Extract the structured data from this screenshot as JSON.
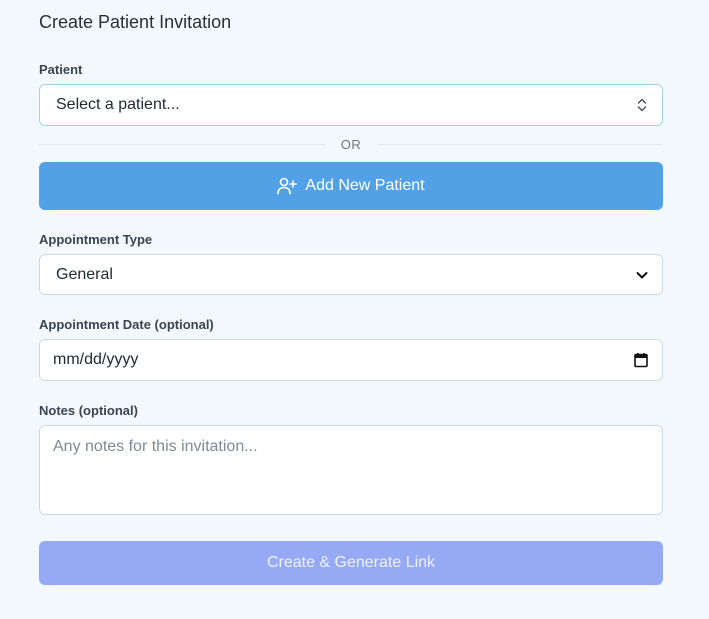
{
  "form": {
    "title": "Create Patient Invitation",
    "patient": {
      "label": "Patient",
      "value": "Select a patient..."
    },
    "divider_text": "OR",
    "add_patient_label": "Add New Patient",
    "appointment_type": {
      "label": "Appointment Type",
      "value": "General"
    },
    "appointment_date": {
      "label": "Appointment Date (optional)",
      "value": "mm/dd/yyyy"
    },
    "notes": {
      "label": "Notes (optional)",
      "placeholder": "Any notes for this invitation..."
    },
    "submit_label": "Create & Generate Link"
  },
  "icons": {
    "select_arrows": "up-down-chevron-icon",
    "dropdown": "chevron-down-icon",
    "calendar": "calendar-icon",
    "add_user": "user-plus-icon"
  },
  "colors": {
    "background": "#f3f8fd",
    "primary_button": "#52a1e6",
    "submit_button_disabled": "#96a9f5"
  }
}
